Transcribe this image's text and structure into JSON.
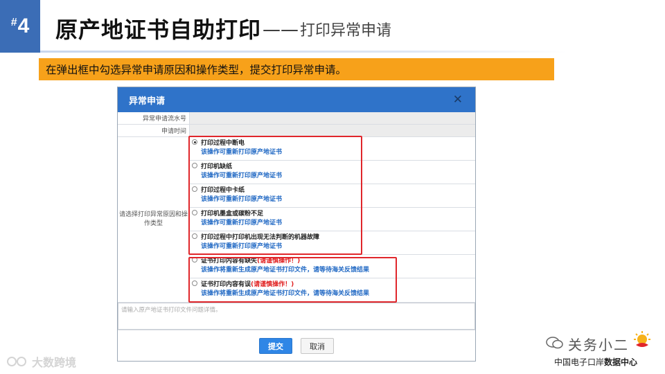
{
  "header": {
    "number_hash": "#",
    "number": "4",
    "title_main": "原产地证书自助打印",
    "title_dash": "——",
    "title_sub": "打印异常申请"
  },
  "instruction": "在弹出框中勾选异常申请原因和操作类型，提交打印异常申请。",
  "dialog": {
    "title": "异常申请",
    "close_icon": "close-icon",
    "fields": {
      "serial_label": "异常申请流水号",
      "serial_value": "",
      "time_label": "申请时间",
      "time_value": "",
      "reason_label": "请选择打印异常原因和操作类型"
    },
    "options": [
      {
        "title": "打印过程中断电",
        "warn": "",
        "desc": "该操作可重新打印原产地证书",
        "checked": true
      },
      {
        "title": "打印机缺纸",
        "warn": "",
        "desc": "该操作可重新打印原产地证书",
        "checked": false
      },
      {
        "title": "打印过程中卡纸",
        "warn": "",
        "desc": "该操作可重新打印原产地证书",
        "checked": false
      },
      {
        "title": "打印机墨盒或碳粉不足",
        "warn": "",
        "desc": "该操作可重新打印原产地证书",
        "checked": false
      },
      {
        "title": "打印过程中打印机出现无法判断的机器故障",
        "warn": "",
        "desc": "该操作可重新打印原产地证书",
        "checked": false
      },
      {
        "title": "证书打印内容有缺失",
        "warn": "(请谨慎操作！)",
        "desc": "该操作将重新生成原产地证书打印文件，请等待海关反馈结果",
        "checked": false
      },
      {
        "title": "证书打印内容有误",
        "warn": "(请谨慎操作！)",
        "desc": "该操作将重新生成原产地证书打印文件，请等待海关反馈结果",
        "checked": false
      }
    ],
    "textarea_placeholder": "请输入原产地证书打印文件问题详情。",
    "submit_label": "提交",
    "cancel_label": "取消"
  },
  "watermarks": {
    "left": "大数跨境",
    "right_account": "关务小二",
    "right_org_prefix": "中国电子口岸",
    "right_org_bold": "数据中心"
  },
  "colors": {
    "accent_blue": "#2f73c9",
    "number_box": "#3b6db6",
    "orange_bar": "#f7a11a",
    "highlight_red": "#e0262b",
    "desc_blue": "#2169c4",
    "warn_red": "#e02020"
  }
}
